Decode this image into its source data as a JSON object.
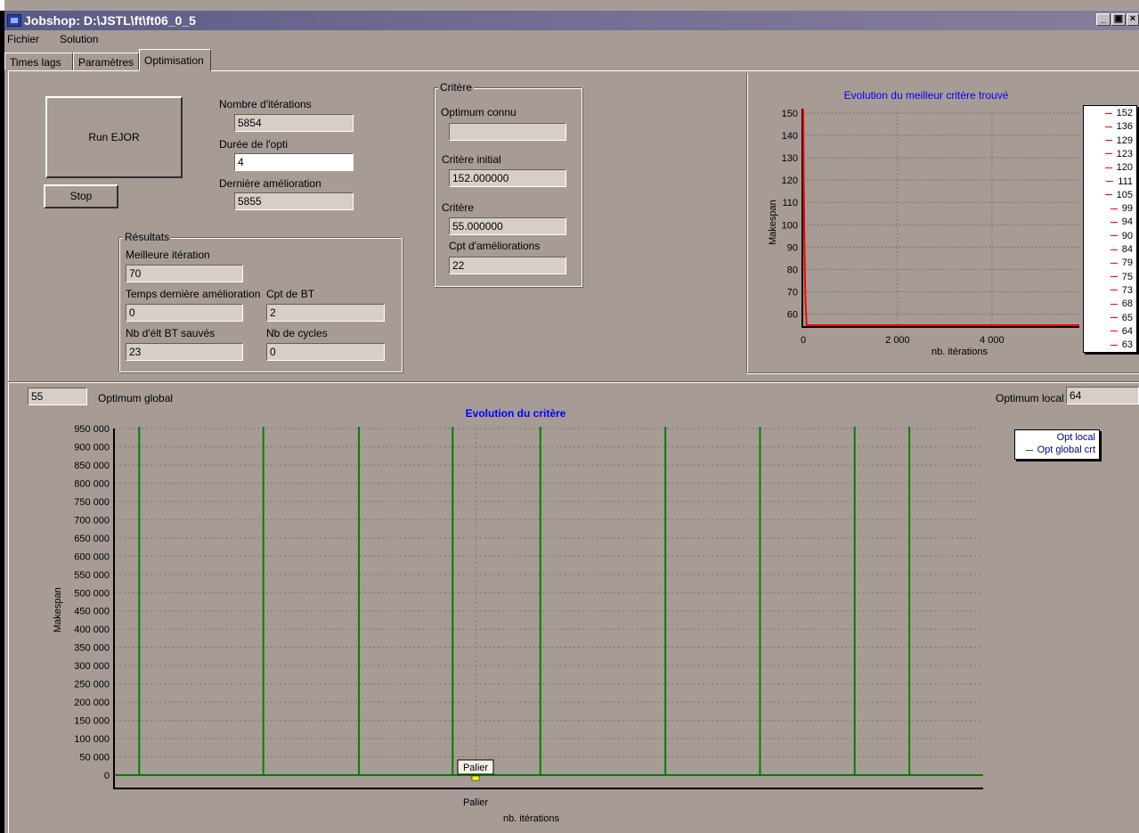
{
  "window": {
    "title": "Jobshop: D:\\JSTL\\ft\\ft06_0_5"
  },
  "menu": {
    "items": [
      "Fichier",
      "Solution"
    ]
  },
  "tabs": [
    "Times lags",
    "Paramètres",
    "Optimisation"
  ],
  "controls": {
    "run_button": "Run EJOR",
    "stop_button": "Stop"
  },
  "iterations": {
    "nb_label": "Nombre d'itérations",
    "nb_value": "5854",
    "duree_label": "Durée de l'opti",
    "duree_value": "4",
    "derniere_label": "Dernière amélioration",
    "derniere_value": "5855"
  },
  "resultats": {
    "title": "Résultats",
    "meilleure_label": "Meilleure itération",
    "meilleure_value": "70",
    "temps_label": "Temps dernière amélioration",
    "temps_value": "0",
    "cptbt_label": "Cpt de BT",
    "cptbt_value": "2",
    "nbelt_label": "Nb d'élt BT sauvés",
    "nbelt_value": "23",
    "nbcycles_label": "Nb de cycles",
    "nbcycles_value": "0"
  },
  "critere": {
    "title": "Critère",
    "optimum_label": "Optimum connu",
    "optimum_value": "",
    "initial_label": "Critère initial",
    "initial_value": "152.000000",
    "critere_label": "Critère",
    "critere_value": "55.000000",
    "cpt_label": "Cpt d'améliorations",
    "cpt_value": "22"
  },
  "optimum_global": {
    "value": "55",
    "label": "Optimum global"
  },
  "optimum_local": {
    "label": "Optimum local",
    "value": "64"
  },
  "colors": {
    "window_bg": "#a79b95",
    "red_series": "#ff0000",
    "green_series": "#008000",
    "title_blue": "#0000ff"
  },
  "chart_data": [
    {
      "type": "line",
      "title": "Evolution du meilleur critère trouvé",
      "xlabel": "nb. itérations",
      "ylabel": "Makespan",
      "xlim": [
        0,
        5854
      ],
      "ylim": [
        55,
        152
      ],
      "x_ticks": [
        "0",
        "2 000",
        "4 000"
      ],
      "y_ticks": [
        150,
        140,
        130,
        120,
        110,
        100,
        90,
        80,
        70,
        60
      ],
      "legend": [
        "152",
        "136",
        "129",
        "123",
        "120",
        "111",
        "105",
        "99",
        "94",
        "90",
        "84",
        "79",
        "75",
        "73",
        "68",
        "65",
        "64",
        "63"
      ],
      "legend_position": "right",
      "grid": true,
      "series": [
        {
          "x": [
            0,
            5,
            10,
            20,
            30,
            40,
            50,
            60,
            70,
            80,
            5854
          ],
          "y": [
            152,
            136,
            120,
            99,
            84,
            73,
            65,
            60,
            55,
            55,
            55
          ]
        }
      ]
    },
    {
      "type": "line",
      "title": "Evolution du critère",
      "xlabel": "nb. itérations",
      "ylabel": "Makespan",
      "ylim": [
        0,
        950000
      ],
      "y_ticks": [
        "950 000",
        "900 000",
        "850 000",
        "800 000",
        "750 000",
        "700 000",
        "650 000",
        "600 000",
        "550 000",
        "500 000",
        "450 000",
        "400 000",
        "350 000",
        "300 000",
        "250 000",
        "200 000",
        "150 000",
        "100 000",
        "50 000",
        "0"
      ],
      "x_ticks": [
        "Palier"
      ],
      "marker_label": "Palier",
      "grid": true,
      "legend": [
        "Opt local",
        "Opt global crt"
      ],
      "legend_position": "top-right",
      "series": [
        {
          "name": "Opt global crt",
          "spikes_at_fraction": [
            0.028,
            0.171,
            0.281,
            0.389,
            0.49,
            0.634,
            0.743,
            0.852,
            0.915
          ],
          "baseline": 0
        }
      ]
    }
  ]
}
